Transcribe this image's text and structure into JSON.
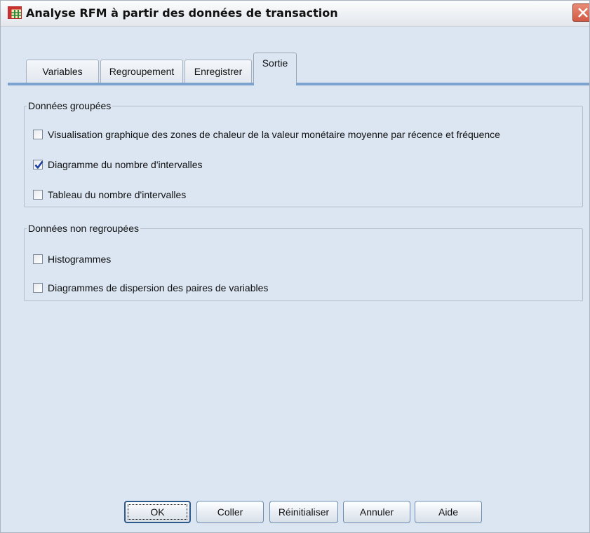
{
  "window": {
    "title": "Analyse RFM à partir des données de transaction"
  },
  "tabs": [
    {
      "label": "Variables",
      "active": false
    },
    {
      "label": "Regroupement",
      "active": false
    },
    {
      "label": "Enregistrer",
      "active": false
    },
    {
      "label": "Sortie",
      "active": true
    }
  ],
  "grouped": {
    "legend": "Données groupées",
    "options": [
      {
        "label": "Visualisation graphique des zones de chaleur de la valeur monétaire moyenne par récence et fréquence",
        "checked": false
      },
      {
        "label": "Diagramme du nombre d'intervalles",
        "checked": true
      },
      {
        "label": "Tableau du nombre d'intervalles",
        "checked": false
      }
    ]
  },
  "ungrouped": {
    "legend": "Données non regroupées",
    "options": [
      {
        "label": "Histogrammes",
        "checked": false
      },
      {
        "label": "Diagrammes de dispersion des paires de variables",
        "checked": false
      }
    ]
  },
  "buttons": {
    "ok": "OK",
    "paste": "Coller",
    "reset": "Réinitialiser",
    "cancel": "Annuler",
    "help": "Aide"
  },
  "colors": {
    "dialog_background": "#dbe6f2",
    "tab_accent": "#7da2ce",
    "close_button": "#d35a44",
    "checkmark": "#1a3fa0"
  },
  "icons": {
    "app": "spss-table-icon",
    "close": "close-icon",
    "check": "checkmark-icon"
  }
}
